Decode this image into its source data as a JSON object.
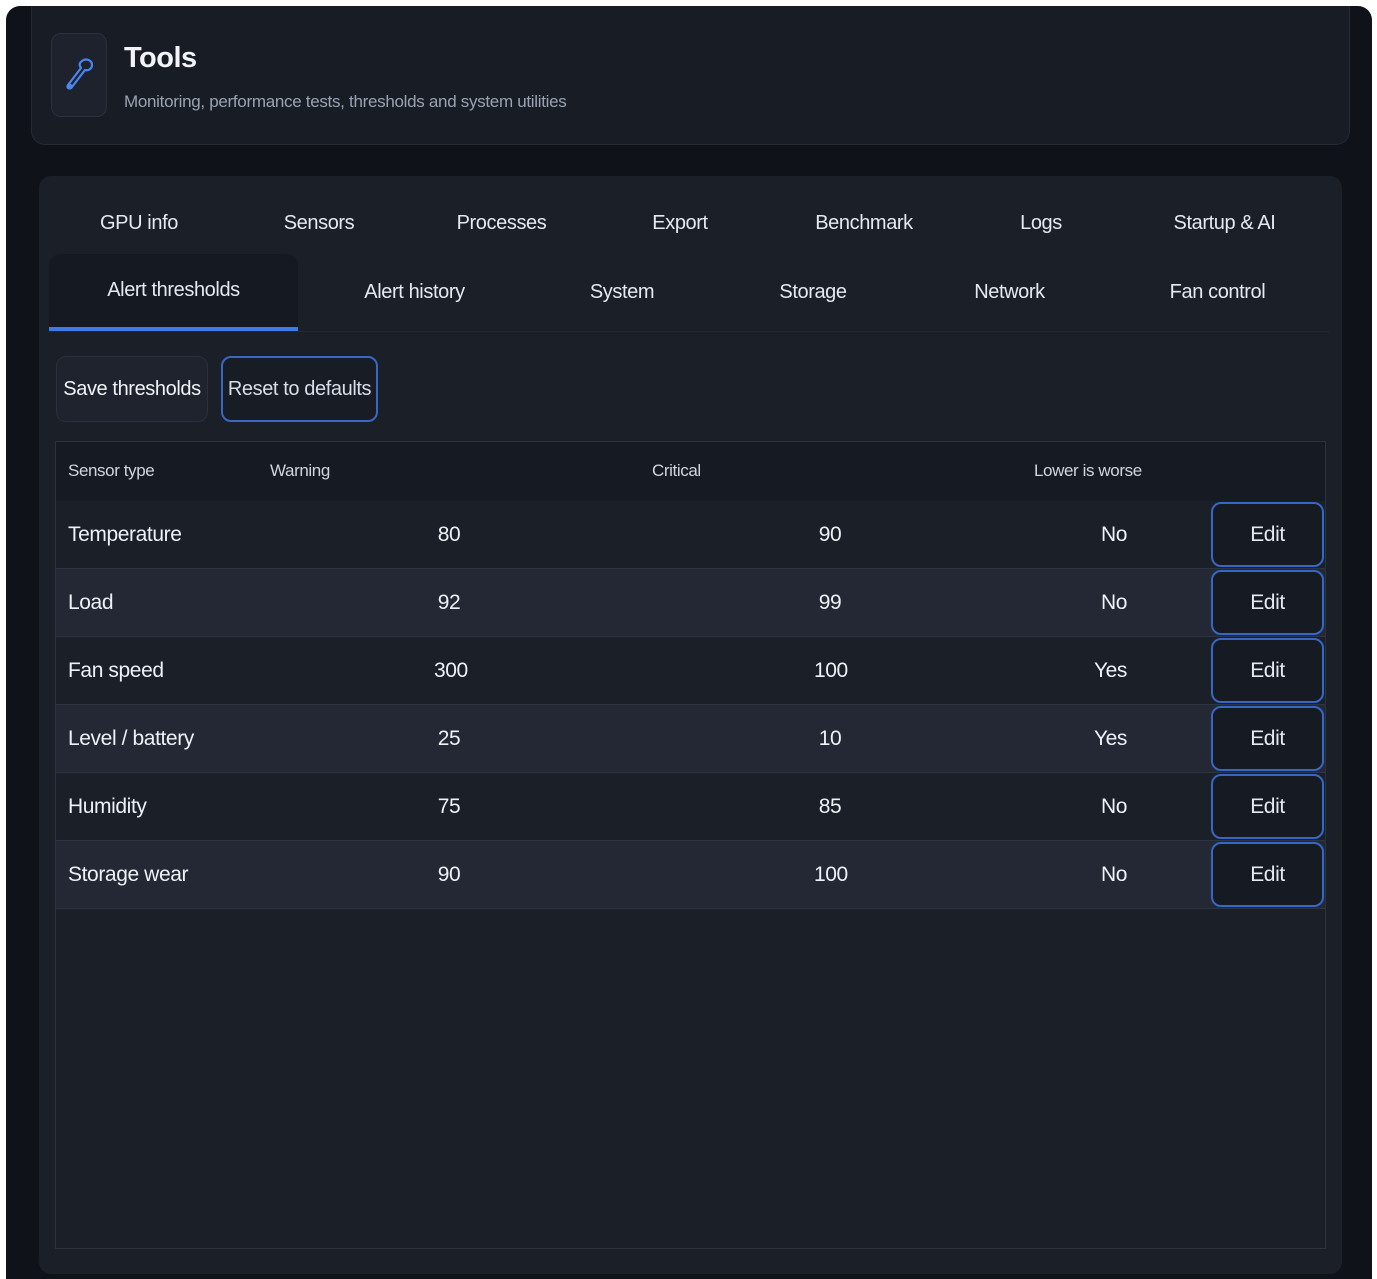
{
  "header": {
    "title": "Tools",
    "subtitle": "Monitoring, performance tests, thresholds and system utilities",
    "icon": "wrench-icon"
  },
  "tabs_row1": [
    "GPU info",
    "Sensors",
    "Processes",
    "Export",
    "Benchmark",
    "Logs",
    "Startup & AI"
  ],
  "tabs_row2": [
    "Alert thresholds",
    "Alert history",
    "System",
    "Storage",
    "Network",
    "Fan control"
  ],
  "active_tab": "Alert thresholds",
  "actions": {
    "save_label": "Save thresholds",
    "reset_label": "Reset to defaults"
  },
  "table": {
    "columns": [
      "Sensor type",
      "Warning",
      "Critical",
      "Lower is worse"
    ],
    "rows": [
      {
        "sensor": "Temperature",
        "warning": "80",
        "critical": "90",
        "lower_is_worse": "No",
        "action": "Edit"
      },
      {
        "sensor": "Load",
        "warning": "92",
        "critical": "99",
        "lower_is_worse": "No",
        "action": "Edit"
      },
      {
        "sensor": "Fan speed",
        "warning": "300",
        "critical": "100",
        "lower_is_worse": "Yes",
        "action": "Edit"
      },
      {
        "sensor": "Level / battery",
        "warning": "25",
        "critical": "10",
        "lower_is_worse": "Yes",
        "action": "Edit"
      },
      {
        "sensor": "Humidity",
        "warning": "75",
        "critical": "85",
        "lower_is_worse": "No",
        "action": "Edit"
      },
      {
        "sensor": "Storage wear",
        "warning": "90",
        "critical": "100",
        "lower_is_worse": "No",
        "action": "Edit"
      }
    ]
  },
  "colors": {
    "accent": "#3d7bea",
    "background": "#0f1218",
    "panel": "#1b1f28"
  }
}
